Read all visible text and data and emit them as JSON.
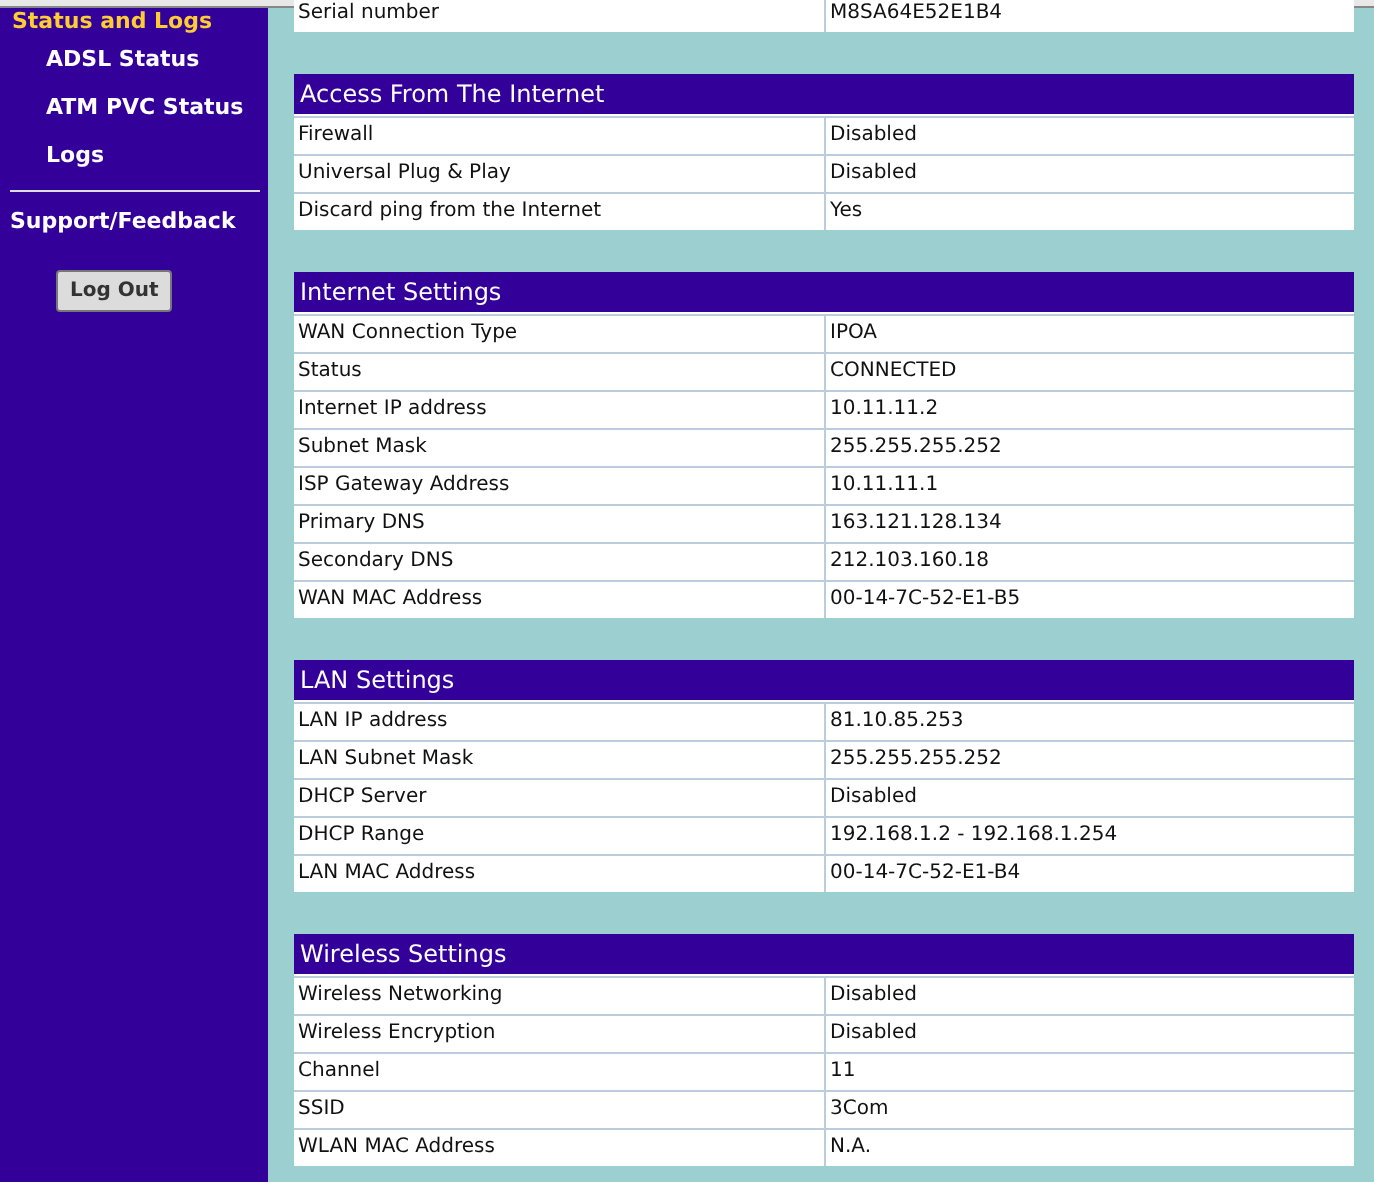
{
  "sidebar": {
    "heading": "Status and Logs",
    "items": [
      {
        "label": "ADSL Status"
      },
      {
        "label": "ATM PVC Status"
      },
      {
        "label": "Logs"
      }
    ],
    "links": [
      {
        "label": "Support/Feedback"
      }
    ],
    "logout_button": "Log Out"
  },
  "sections": [
    {
      "rows": [
        {
          "label": "Serial number",
          "value": "M8SA64E52E1B4"
        }
      ]
    },
    {
      "title": "Access From The Internet",
      "rows": [
        {
          "label": "Firewall",
          "value": "Disabled"
        },
        {
          "label": "Universal Plug & Play",
          "value": "Disabled"
        },
        {
          "label": "Discard ping from the Internet",
          "value": "Yes"
        }
      ]
    },
    {
      "title": "Internet Settings",
      "rows": [
        {
          "label": "WAN Connection Type",
          "value": "IPOA"
        },
        {
          "label": "Status",
          "value": "CONNECTED"
        },
        {
          "label": "Internet IP address",
          "value": "10.11.11.2"
        },
        {
          "label": "Subnet Mask",
          "value": "255.255.255.252"
        },
        {
          "label": "ISP Gateway Address",
          "value": "10.11.11.1"
        },
        {
          "label": "Primary DNS",
          "value": "163.121.128.134"
        },
        {
          "label": "Secondary DNS",
          "value": "212.103.160.18"
        },
        {
          "label": "WAN MAC Address",
          "value": "00-14-7C-52-E1-B5"
        }
      ]
    },
    {
      "title": "LAN Settings",
      "rows": [
        {
          "label": "LAN IP address",
          "value": "81.10.85.253"
        },
        {
          "label": "LAN Subnet Mask",
          "value": "255.255.255.252"
        },
        {
          "label": "DHCP Server",
          "value": "Disabled"
        },
        {
          "label": "DHCP Range",
          "value": "192.168.1.2 - 192.168.1.254"
        },
        {
          "label": "LAN MAC Address",
          "value": "00-14-7C-52-E1-B4"
        }
      ]
    },
    {
      "title": "Wireless Settings",
      "rows": [
        {
          "label": "Wireless Networking",
          "value": "Disabled"
        },
        {
          "label": "Wireless Encryption",
          "value": "Disabled"
        },
        {
          "label": "Channel",
          "value": "11"
        },
        {
          "label": "SSID",
          "value": "3Com"
        },
        {
          "label": "WLAN MAC Address",
          "value": "N.A."
        }
      ]
    }
  ]
}
